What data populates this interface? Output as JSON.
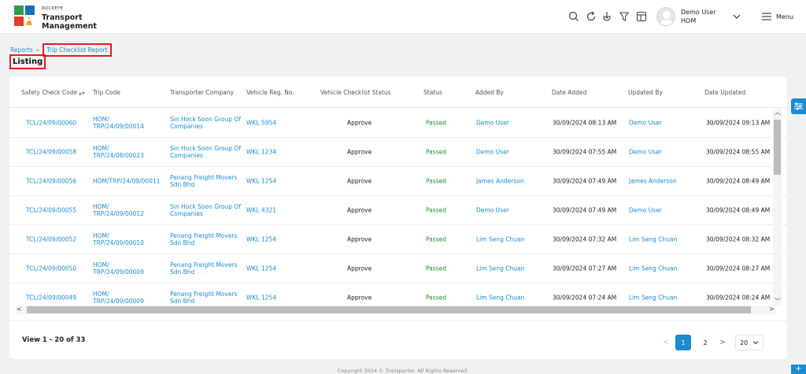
{
  "header": {
    "brand_small": "ROCKEYE",
    "brand_line1": "Transport",
    "brand_line2": "Management",
    "user_name": "Demo User",
    "user_org": "HOM",
    "menu_label": "Menu",
    "icons": [
      "search-icon",
      "refresh-icon",
      "download-icon",
      "filter-icon",
      "table-icon"
    ]
  },
  "breadcrumb": {
    "root": "Reports",
    "separator": "»",
    "current": "Trip Checklist Report"
  },
  "page_title": "Listing",
  "table": {
    "columns": [
      "Safety Check Code",
      "Trip Code",
      "Transporter Company",
      "Vehicle Reg. No.",
      "Vehicle Checklist Status",
      "Status",
      "Added By",
      "Date Added",
      "Updated By",
      "Date Updated"
    ],
    "sort_indicator": "▲▼",
    "rows": [
      {
        "code": "TCL/24/09/00060",
        "trip_l1": "HOM/",
        "trip_l2": "TRP/24/09/00014",
        "comp_l1": "Sin Hock Soon Group Of",
        "comp_l2": "Companies",
        "vehicle": "WKL 5954",
        "checklist": "Approve",
        "status": "Passed",
        "added_by": "Demo User",
        "date_added": "30/09/2024 08:13 AM",
        "updated_by": "Demo User",
        "date_updated": "30/09/2024 09:13 AM"
      },
      {
        "code": "TCL/24/09/00058",
        "trip_l1": "HOM/",
        "trip_l2": "TRP/24/08/00023",
        "comp_l1": "Sin Hock Soon Group Of",
        "comp_l2": "Companies",
        "vehicle": "WKL 1234",
        "checklist": "Approve",
        "status": "Passed",
        "added_by": "Demo User",
        "date_added": "30/09/2024 07:55 AM",
        "updated_by": "Demo User",
        "date_updated": "30/09/2024 08:55 AM"
      },
      {
        "code": "TCL/24/09/00056",
        "trip_l1": "HOM/TRP/24/09/00011",
        "trip_l2": "",
        "comp_l1": "Penang Freight Movers",
        "comp_l2": "Sdn Bhd",
        "vehicle": "WKL 1254",
        "checklist": "Approve",
        "status": "Passed",
        "added_by": "James Anderson",
        "date_added": "30/09/2024 07:49 AM",
        "updated_by": "James Anderson",
        "date_updated": "30/09/2024 08:49 AM"
      },
      {
        "code": "TCL/24/09/00055",
        "trip_l1": "HOM/",
        "trip_l2": "TRP/24/09/00012",
        "comp_l1": "Sin Hock Soon Group Of",
        "comp_l2": "Companies",
        "vehicle": "WKL 4321",
        "checklist": "Approve",
        "status": "Passed",
        "added_by": "Demo User",
        "date_added": "30/09/2024 07:49 AM",
        "updated_by": "Demo User",
        "date_updated": "30/09/2024 08:49 AM"
      },
      {
        "code": "TCL/24/09/00052",
        "trip_l1": "HOM/",
        "trip_l2": "TRP/24/09/00010",
        "comp_l1": "Penang Freight Movers",
        "comp_l2": "Sdn Bhd",
        "vehicle": "WKL 1254",
        "checklist": "Approve",
        "status": "Passed",
        "added_by": "Lim Seng Chuan",
        "date_added": "30/09/2024 07:32 AM",
        "updated_by": "Lim Seng Chuan",
        "date_updated": "30/09/2024 08:32 AM"
      },
      {
        "code": "TCL/24/09/00050",
        "trip_l1": "HOM/",
        "trip_l2": "TRP/24/09/00009",
        "comp_l1": "Penang Freight Movers",
        "comp_l2": "Sdn Bhd",
        "vehicle": "WKL 1254",
        "checklist": "Approve",
        "status": "Passed",
        "added_by": "Lim Seng Chuan",
        "date_added": "30/09/2024 07:27 AM",
        "updated_by": "Lim Seng Chuan",
        "date_updated": "30/09/2024 08:27 AM"
      },
      {
        "code": "TCL/24/09/00049",
        "trip_l1": "HOM/",
        "trip_l2": "TRP/24/09/00009",
        "comp_l1": "Penang Freight Movers",
        "comp_l2": "Sdn Bhd",
        "vehicle": "WKL 1254",
        "checklist": "Approve",
        "status": "Passed",
        "added_by": "Lim Seng Chuan",
        "date_added": "30/09/2024 07:24 AM",
        "updated_by": "Lim Seng Chuan",
        "date_updated": "30/09/2024 08:24 AM"
      }
    ]
  },
  "footer": {
    "view_count": "View 1 - 20 of 33",
    "pages": [
      "1",
      "2"
    ],
    "active_page": "1",
    "page_size": "20",
    "copyright": "Copyright 2024 © Transporter. All Rights Reserved."
  },
  "colors": {
    "accent": "#1c8bd1",
    "passed": "#1e8f2f",
    "highlight": "#e41d1d"
  }
}
